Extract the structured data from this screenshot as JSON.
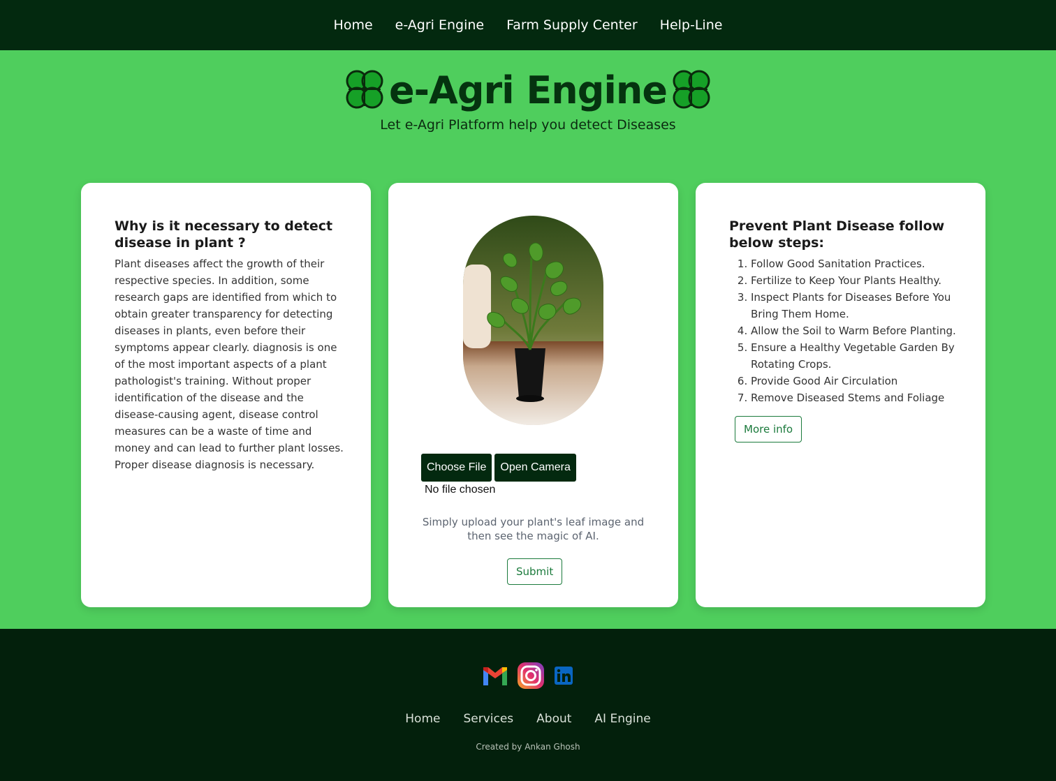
{
  "nav": {
    "items": [
      "Home",
      "e-Agri Engine",
      "Farm Supply Center",
      "Help-Line"
    ]
  },
  "hero": {
    "title": "e-Agri Engine",
    "tagline": "Let e-Agri Platform help you detect Diseases",
    "icon": "clover-icon"
  },
  "left_card": {
    "heading": "Why is it necessary to detect disease in plant ?",
    "body": "Plant diseases affect the growth of their respective species. In addition, some research gaps are identified from which to obtain greater transparency for detecting diseases in plants, even before their symptoms appear clearly. diagnosis is one of the most important aspects of a plant pathologist's training. Without proper identification of the disease and the disease-causing agent, disease control measures can be a waste of time and money and can lead to further plant losses. Proper disease diagnosis is necessary."
  },
  "upload_card": {
    "choose_file": "Choose File",
    "open_camera": "Open Camera",
    "file_status": "No file chosen",
    "hint": "Simply upload your plant's leaf image and then see the magic of AI.",
    "submit": "Submit"
  },
  "right_card": {
    "heading": "Prevent Plant Disease follow below steps:",
    "steps": [
      "Follow Good Sanitation Practices.",
      "Fertilize to Keep Your Plants Healthy.",
      "Inspect Plants for Diseases Before You Bring Them Home.",
      "Allow the Soil to Warm Before Planting.",
      "Ensure a Healthy Vegetable Garden By Rotating Crops.",
      "Provide Good Air Circulation",
      "Remove Diseased Stems and Foliage"
    ],
    "more_info": "More info"
  },
  "footer": {
    "social": [
      "gmail-icon",
      "instagram-icon",
      "linkedin-icon"
    ],
    "links": [
      "Home",
      "Services",
      "About",
      "AI Engine"
    ],
    "credit": "Created by Ankan Ghosh"
  },
  "colors": {
    "nav_bg": "#03290f",
    "page_bg": "#4fce5d",
    "accent": "#1b7a3c"
  }
}
